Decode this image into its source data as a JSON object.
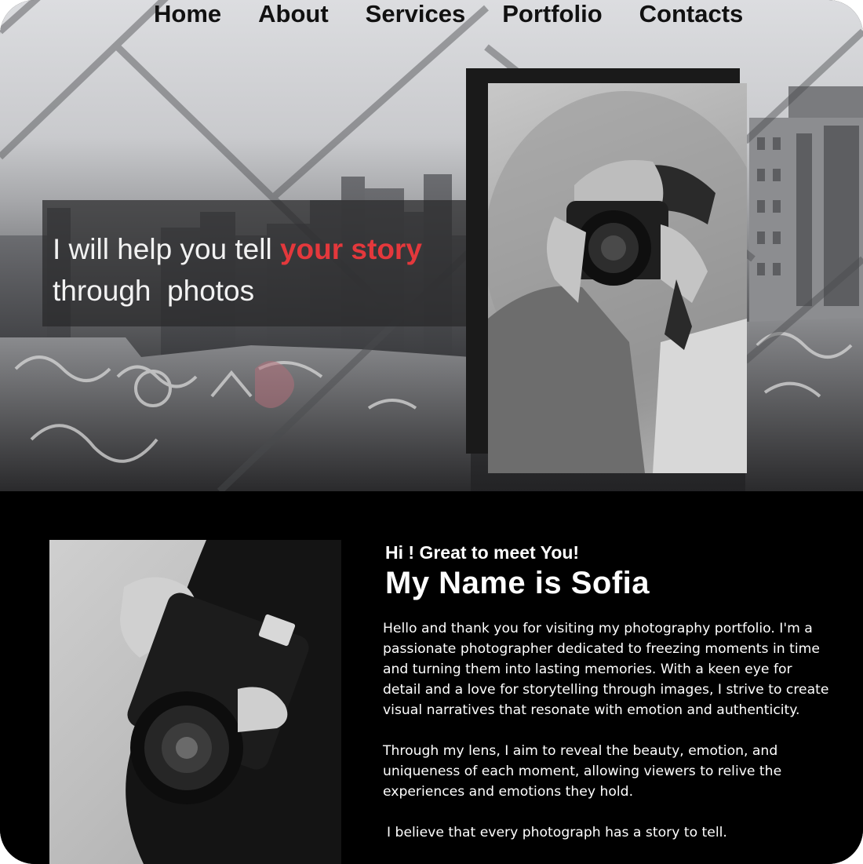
{
  "nav": {
    "items": [
      {
        "label": "Home"
      },
      {
        "label": "About"
      },
      {
        "label": "Services"
      },
      {
        "label": "Portfolio"
      },
      {
        "label": "Contacts"
      }
    ]
  },
  "hero": {
    "line1_before": "I will help you tell ",
    "line1_accent": "your story",
    "line2": "through  photos",
    "accent_color": "#e4383c"
  },
  "about": {
    "greeting": "Hi ! Great to meet You!",
    "name": "My Name is Sofia",
    "paragraphs": [
      "Hello and thank you for visiting my photography portfolio. I'm a passionate photographer dedicated to freezing moments in time and turning them into lasting memories. With a keen eye for detail and a love for storytelling through images, I strive to create visual narratives that resonate with emotion and authenticity.",
      "Through my lens, I aim to reveal the beauty, emotion, and uniqueness of each moment, allowing viewers to relive the experiences and emotions they hold.",
      "I believe that every photograph has a story to tell."
    ]
  },
  "icons": {
    "hero_background": "city-rooftops-graffiti-photo",
    "hero_portrait": "photographer-with-camera-photo",
    "about_portrait": "hands-holding-camera-photo"
  }
}
